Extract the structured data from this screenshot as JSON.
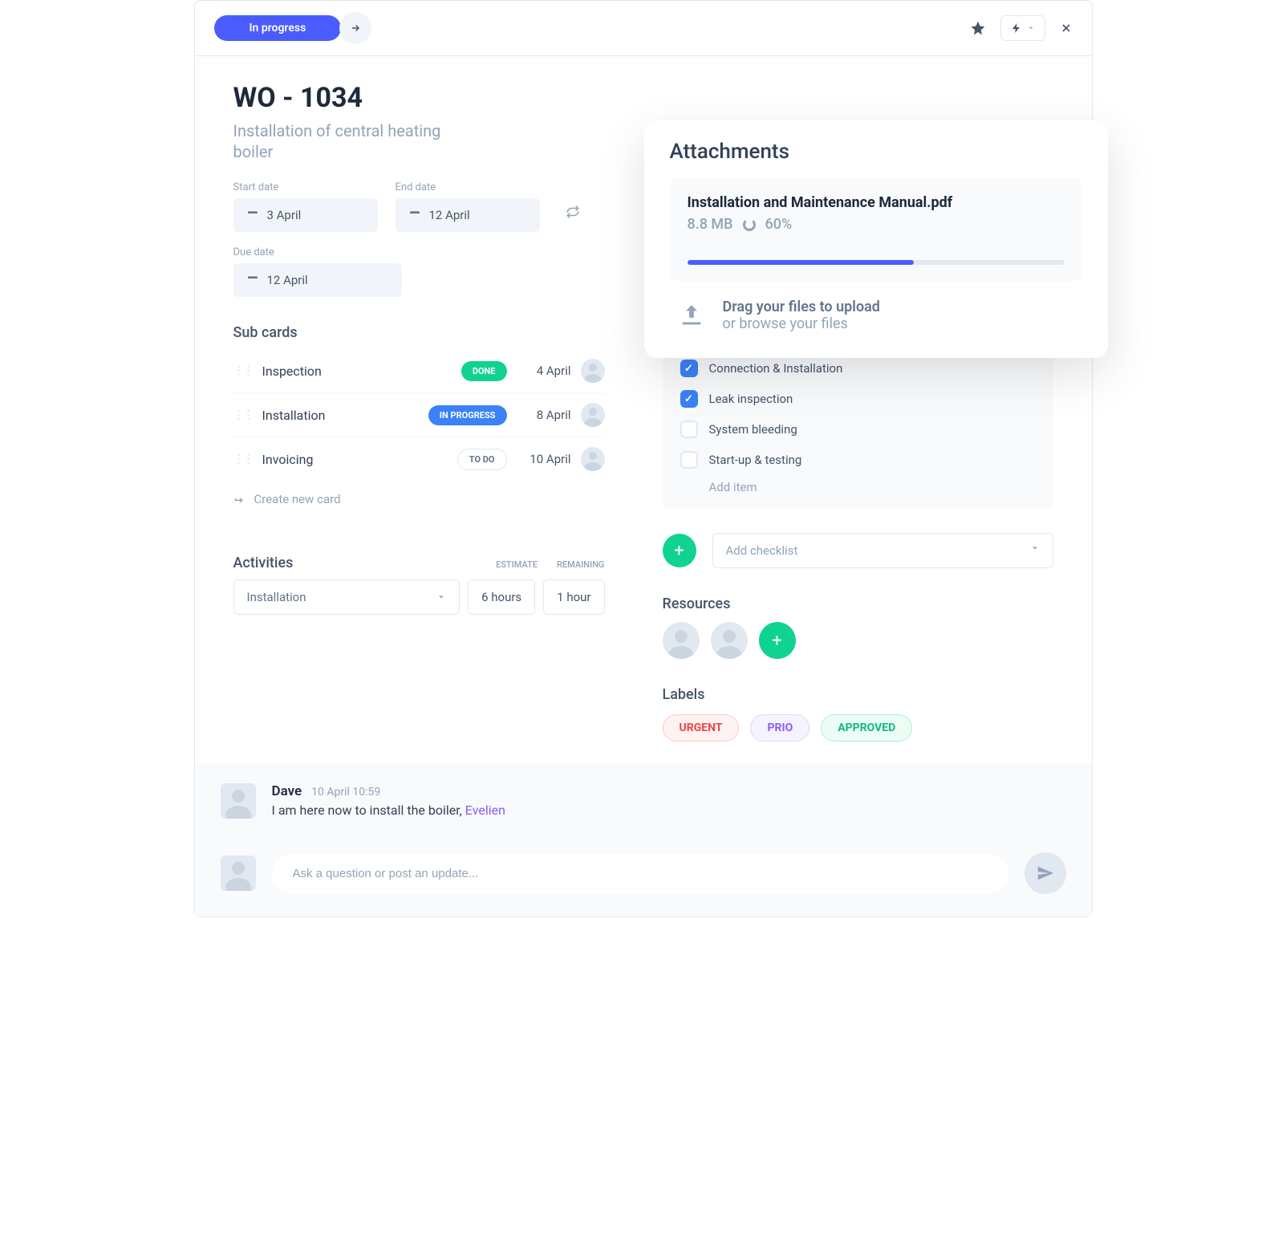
{
  "header": {
    "status": "In progress"
  },
  "wo": {
    "code": "WO - 1034",
    "title": "Installation of central heating boiler"
  },
  "dates": {
    "start_label": "Start date",
    "start": "3 April",
    "end_label": "End date",
    "end": "12 April",
    "due_label": "Due date",
    "due": "12 April"
  },
  "subcards": {
    "heading": "Sub cards",
    "items": [
      {
        "name": "Inspection",
        "status": "DONE",
        "status_cls": "badge-done",
        "date": "4 April"
      },
      {
        "name": "Installation",
        "status": "IN PROGRESS",
        "status_cls": "badge-progress",
        "date": "8 April"
      },
      {
        "name": "Invoicing",
        "status": "TO DO",
        "status_cls": "badge-todo",
        "date": "10 April"
      }
    ],
    "create": "Create new card"
  },
  "activities": {
    "heading": "Activities",
    "col_estimate": "ESTIMATE",
    "col_remaining": "REMAINING",
    "selected": "Installation",
    "estimate": "6 hours",
    "remaining": "1 hour"
  },
  "attachments": {
    "heading": "Attachments",
    "file": {
      "name": "Installation and Maintenance Manual.pdf",
      "size": "8.8 MB",
      "percent": "60%",
      "percent_num": 60
    },
    "dropzone": {
      "l1": "Drag your files to upload",
      "l2": "or browse your files"
    }
  },
  "checklist": {
    "items": [
      {
        "label": "Connection & Installation",
        "checked": true
      },
      {
        "label": "Leak inspection",
        "checked": true
      },
      {
        "label": "System bleeding",
        "checked": false
      },
      {
        "label": "Start-up & testing",
        "checked": false
      }
    ],
    "add_item": "Add item",
    "add_checklist": "Add checklist"
  },
  "resources": {
    "heading": "Resources"
  },
  "labels": {
    "heading": "Labels",
    "items": [
      {
        "text": "URGENT",
        "cls": "tag-urgent"
      },
      {
        "text": "PRIO",
        "cls": "tag-prio"
      },
      {
        "text": "APPROVED",
        "cls": "tag-approved"
      }
    ]
  },
  "comment": {
    "author": "Dave",
    "time": "10 April 10:59",
    "text": "I am here now to install the boiler, ",
    "mention": "Evelien"
  },
  "input": {
    "placeholder": "Ask a question or post an update..."
  }
}
